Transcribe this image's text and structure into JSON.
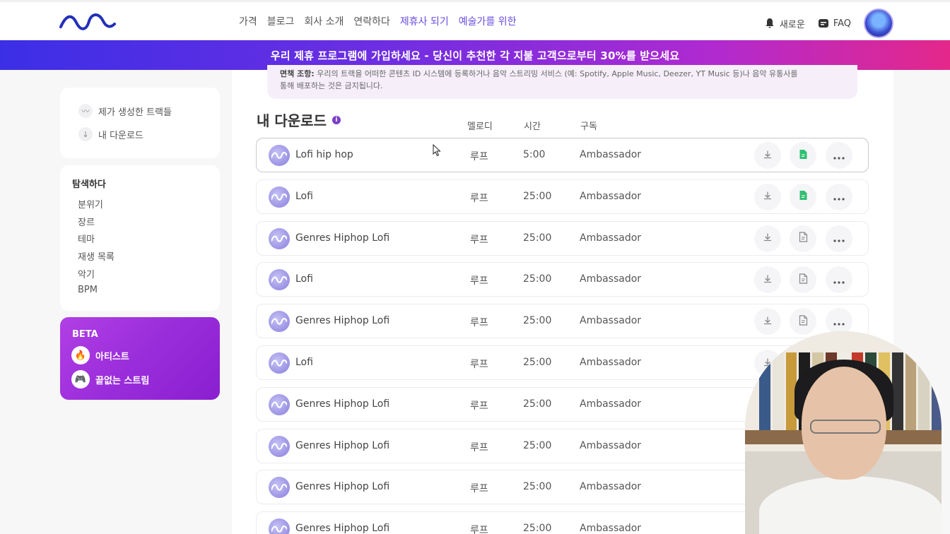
{
  "header": {
    "nav": [
      "가격",
      "블로그",
      "회사 소개",
      "연락하다",
      "제휴사 되기",
      "예술가를 위한"
    ],
    "notifications_label": "새로운",
    "faq_label": "FAQ"
  },
  "banner": {
    "text": "우리 제휴 프로그램에 가입하세요 - 당신이 추천한 각 지불 고객으로부터 30%를 받으세요"
  },
  "notice": {
    "label": "면책 조항:",
    "text": "우리의 트랙을 어떠한 콘텐츠 ID 시스템에 등록하거나 음악 스트리밍 서비스 (예: Spotify, Apple Music, Deezer, YT Music 등)나 음악 유통사를",
    "text2": "통해 배포하는 것은 금지됩니다."
  },
  "sidebar": {
    "links": [
      "제가 생성한 트랙들",
      "내 다운로드"
    ],
    "explore_title": "탐색하다",
    "explore_items": [
      "분위기",
      "장르",
      "테마",
      "재생 목록",
      "악기",
      "BPM"
    ],
    "beta_label": "BETA",
    "beta_items": [
      "아티스트",
      "끝없는 스트림"
    ]
  },
  "downloads": {
    "title": "내 다운로드",
    "columns": {
      "melody": "멜로디",
      "time": "시간",
      "subscription": "구독"
    },
    "rows": [
      {
        "title": "Lofi hip hop",
        "melody": "루프",
        "time": "5:00",
        "subscription": "Ambassador",
        "license": "active"
      },
      {
        "title": "Lofi",
        "melody": "루프",
        "time": "25:00",
        "subscription": "Ambassador",
        "license": "active"
      },
      {
        "title": "Genres Hiphop Lofi",
        "melody": "루프",
        "time": "25:00",
        "subscription": "Ambassador",
        "license": "inactive"
      },
      {
        "title": "Lofi",
        "melody": "루프",
        "time": "25:00",
        "subscription": "Ambassador",
        "license": "inactive"
      },
      {
        "title": "Genres Hiphop Lofi",
        "melody": "루프",
        "time": "25:00",
        "subscription": "Ambassador",
        "license": "inactive"
      },
      {
        "title": "Lofi",
        "melody": "루프",
        "time": "25:00",
        "subscription": "Ambassador",
        "license": "inactive"
      },
      {
        "title": "Genres Hiphop Lofi",
        "melody": "루프",
        "time": "25:00",
        "subscription": "Ambassador",
        "license": "inactive"
      },
      {
        "title": "Genres Hiphop Lofi",
        "melody": "루프",
        "time": "25:00",
        "subscription": "Ambassador",
        "license": "inactive"
      },
      {
        "title": "Genres Hiphop Lofi",
        "melody": "루프",
        "time": "25:00",
        "subscription": "Ambassador",
        "license": "inactive"
      },
      {
        "title": "Genres Hiphop Lofi",
        "melody": "루프",
        "time": "25:00",
        "subscription": "Ambassador",
        "license": "inactive"
      }
    ]
  },
  "colors": {
    "accent": "#6a4be0",
    "license_active": "#2fbf71",
    "beta_bg": "#a033dc"
  }
}
